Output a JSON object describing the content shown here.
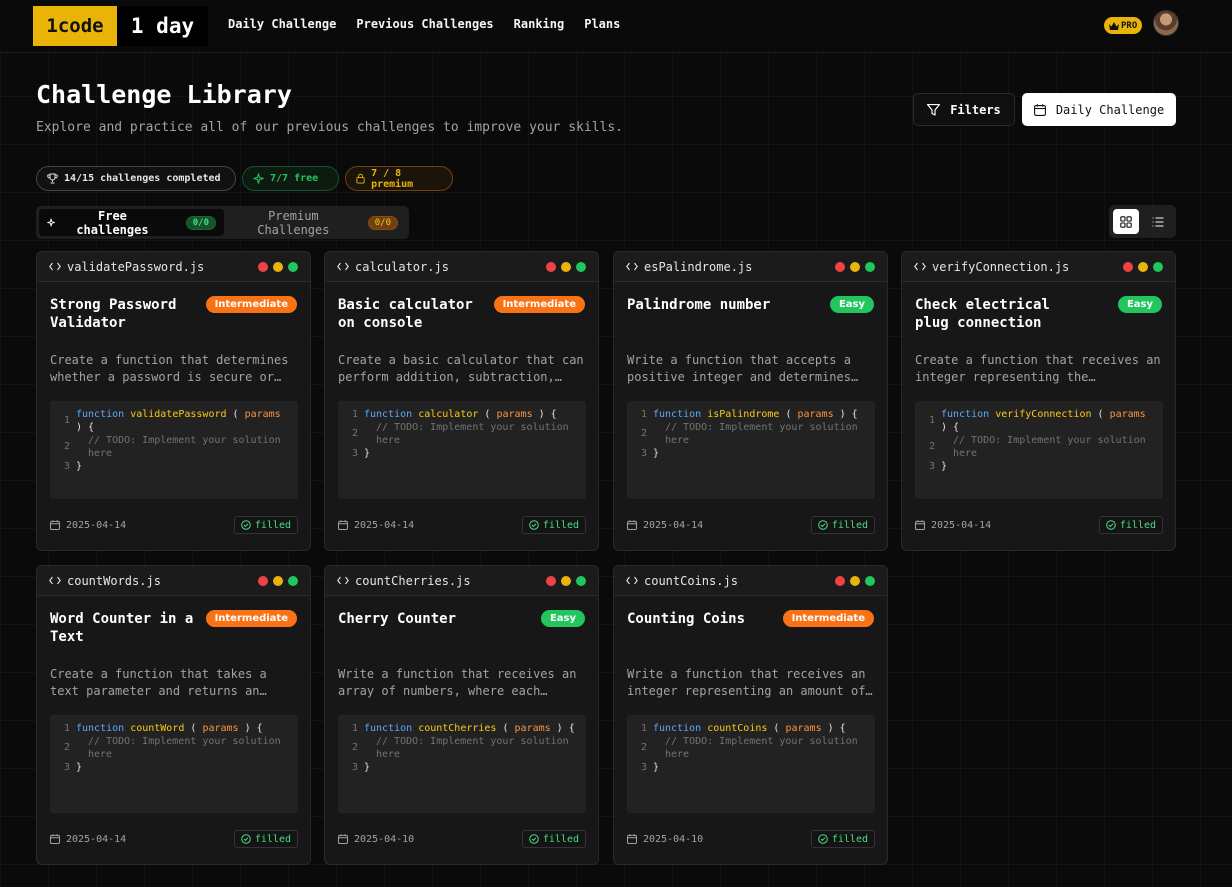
{
  "nav": {
    "logo_code": "1code",
    "logo_day": "1 day",
    "links": [
      "Daily Challenge",
      "Previous Challenges",
      "Ranking",
      "Plans"
    ],
    "pro_label": "PRO"
  },
  "header": {
    "title": "Challenge Library",
    "subtitle": "Explore and practice all of our previous challenges to improve your skills.",
    "filters_label": "Filters",
    "daily_label": "Daily Challenge"
  },
  "stats": {
    "completed": "14/15 challenges completed",
    "free": "7/7 free",
    "premium": "7 / 8 premium"
  },
  "tabs": {
    "free_label": "Free challenges",
    "free_count": "0/0",
    "premium_label": "Premium Challenges",
    "premium_count": "0/0"
  },
  "colors": {
    "accent": "#eab308",
    "intermediate": "#f97316",
    "easy": "#22c55e"
  },
  "cards": [
    {
      "file": "validatePassword.js",
      "title": "Strong Password Validator",
      "level": "Intermediate",
      "desc": "Create a function that determines whether a password is secure or not based on a set of rules.",
      "fn": "validatePassword",
      "params": "params",
      "wrap": true,
      "comment": "// TODO: Implement your solution",
      "comment2": "here",
      "date": "2025-04-14",
      "status": "filled"
    },
    {
      "file": "calculator.js",
      "title": "Basic calculator on console",
      "level": "Intermediate",
      "desc": "Create a basic calculator that can perform addition, subtraction, multiplication and division.",
      "fn": "calculator",
      "params": "params",
      "wrap": false,
      "comment": "// TODO: Implement your solution",
      "comment2": "here",
      "date": "2025-04-14",
      "status": "filled"
    },
    {
      "file": "esPalindrome.js",
      "title": "Palindrome number",
      "level": "Easy",
      "desc": "Write a function that accepts a positive integer and determines whether it is a palindrome.",
      "fn": "isPalindrome",
      "params": "params",
      "wrap": false,
      "comment": "// TODO: Implement your solution",
      "comment2": "here",
      "date": "2025-04-14",
      "status": "filled"
    },
    {
      "file": "verifyConnection.js",
      "title": "Check electrical plug connection",
      "level": "Easy",
      "desc": "Create a function that receives an integer representing the connection type of a plug.",
      "fn": "verifyConnection",
      "params": "params",
      "wrap": true,
      "comment": "// TODO: Implement your solution",
      "comment2": "here",
      "date": "2025-04-14",
      "status": "filled"
    },
    {
      "file": "countWords.js",
      "title": "Word Counter in a Text",
      "level": "Intermediate",
      "desc": "Create a function that takes a text parameter and returns an object with the count of each word.",
      "fn": "countWord",
      "params": "params",
      "wrap": false,
      "comment": "// TODO: Implement your solution",
      "comment2": "here",
      "date": "2025-04-14",
      "status": "filled"
    },
    {
      "file": "countCherries.js",
      "title": "Cherry Counter",
      "level": "Easy",
      "desc": "Write a function that receives an array of numbers, where each number represents cherries.",
      "fn": "countCherries",
      "params": "params",
      "wrap": false,
      "comment": "// TODO: Implement your solution",
      "comment2": "here",
      "date": "2025-04-10",
      "status": "filled"
    },
    {
      "file": "countCoins.js",
      "title": "Counting Coins",
      "level": "Intermediate",
      "desc": "Write a function that receives an integer representing an amount of money in cents.",
      "fn": "countCoins",
      "params": "params",
      "wrap": false,
      "comment": "// TODO: Implement your solution",
      "comment2": "here",
      "date": "2025-04-10",
      "status": "filled"
    }
  ]
}
